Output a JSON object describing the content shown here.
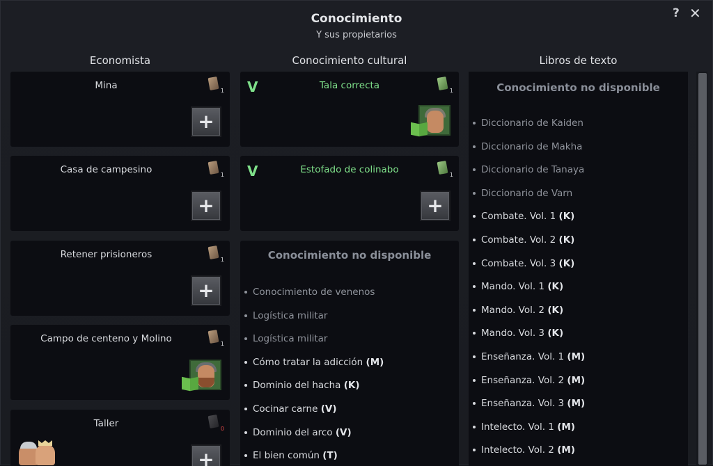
{
  "header": {
    "title": "Conocimiento",
    "subtitle": "Y sus propietarios",
    "help": "?",
    "close": "✕"
  },
  "columns": {
    "economist": "Economista",
    "cultural": "Conocimiento cultural",
    "textbooks": "Libros de texto"
  },
  "economist_cards": [
    {
      "label": "Mina",
      "count": "1"
    },
    {
      "label": "Casa de campesino",
      "count": "1"
    },
    {
      "label": "Retener prisioneros",
      "count": "1"
    },
    {
      "label": "Campo de centeno y Molino",
      "count": "1"
    },
    {
      "label": "Taller",
      "count": "0"
    }
  ],
  "cultural_cards": [
    {
      "label": "Tala correcta",
      "count": "1",
      "check": "V"
    },
    {
      "label": "Estofado de colinabo",
      "count": "1",
      "check": "V"
    }
  ],
  "cultural_unavailable": {
    "title": "Conocimiento no disponible",
    "items": [
      {
        "text": "Conocimiento de venenos",
        "tag": ""
      },
      {
        "text": "Logística militar",
        "tag": ""
      },
      {
        "text": "Logística militar",
        "tag": ""
      },
      {
        "text": "Cómo tratar la adicción",
        "tag": "(M)"
      },
      {
        "text": "Dominio del hacha",
        "tag": "(K)"
      },
      {
        "text": "Cocinar carne",
        "tag": "(V)"
      },
      {
        "text": "Dominio del arco",
        "tag": "(V)"
      },
      {
        "text": "El bien común",
        "tag": "(T)"
      }
    ]
  },
  "textbooks_unavailable": {
    "title": "Conocimiento no disponible",
    "items": [
      {
        "text": "Diccionario de Kaiden",
        "tag": ""
      },
      {
        "text": "Diccionario de Makha",
        "tag": ""
      },
      {
        "text": "Diccionario de Tanaya",
        "tag": ""
      },
      {
        "text": "Diccionario de Varn",
        "tag": ""
      },
      {
        "text": "Combate. Vol. 1",
        "tag": "(K)"
      },
      {
        "text": "Combate. Vol. 2",
        "tag": "(K)"
      },
      {
        "text": "Combate. Vol. 3",
        "tag": "(K)"
      },
      {
        "text": "Mando. Vol. 1",
        "tag": "(K)"
      },
      {
        "text": "Mando. Vol. 2",
        "tag": "(K)"
      },
      {
        "text": "Mando. Vol. 3",
        "tag": "(K)"
      },
      {
        "text": "Enseñanza. Vol. 1",
        "tag": "(M)"
      },
      {
        "text": "Enseñanza. Vol. 2",
        "tag": "(M)"
      },
      {
        "text": "Enseñanza. Vol. 3",
        "tag": "(M)"
      },
      {
        "text": "Intelecto. Vol. 1",
        "tag": "(M)"
      },
      {
        "text": "Intelecto. Vol. 2",
        "tag": "(M)"
      }
    ]
  },
  "plus_label": "+"
}
